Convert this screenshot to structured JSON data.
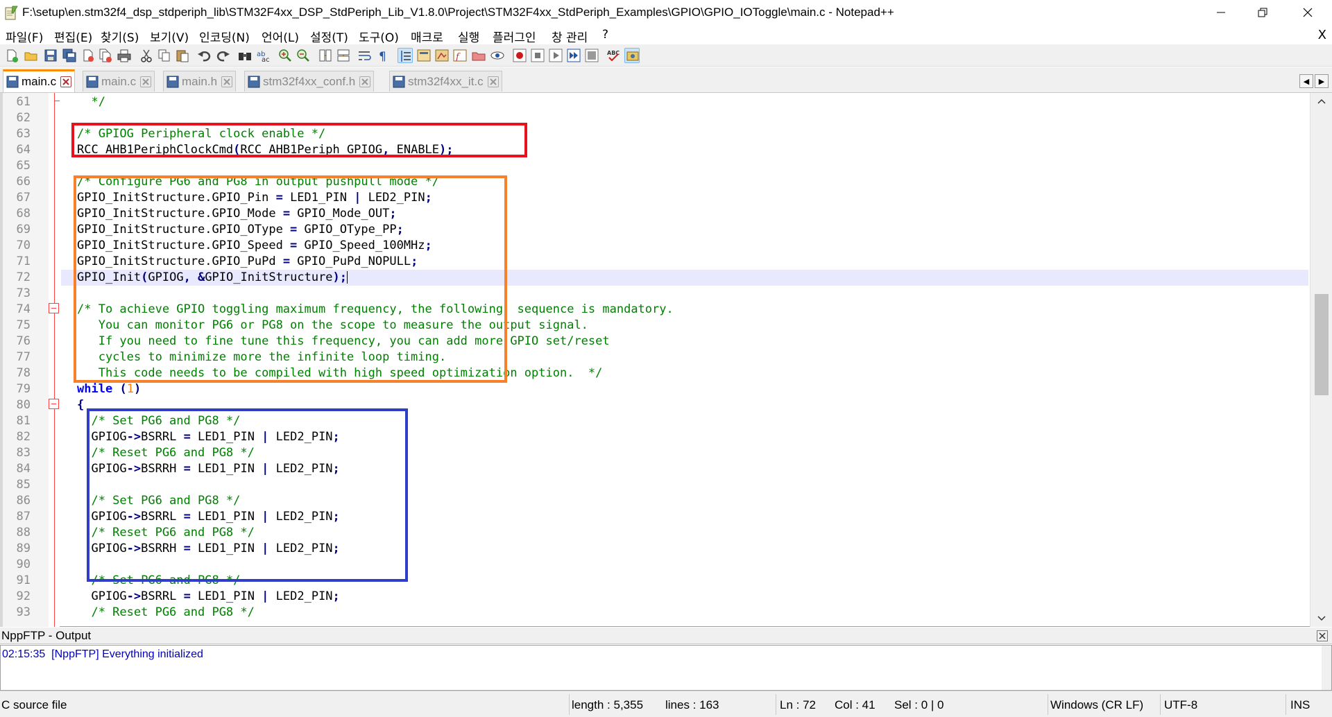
{
  "window": {
    "title": "F:\\setup\\en.stm32f4_dsp_stdperiph_lib\\STM32F4xx_DSP_StdPeriph_Lib_V1.8.0\\Project\\STM32F4xx_StdPeriph_Examples\\GPIO\\GPIO_IOToggle\\main.c - Notepad++",
    "app_icon": "notepad-plus-plus-icon",
    "minimize_icon": "minimize-icon",
    "restore_icon": "restore-icon",
    "close_icon": "close-icon"
  },
  "menu": {
    "items": [
      "파일(F)",
      "편집(E)",
      "찾기(S)",
      "보기(V)",
      "인코딩(N)",
      "언어(L)",
      "설정(T)",
      "도구(O)",
      "매크로",
      "실행",
      "플러그인",
      "창 관리",
      "?"
    ],
    "close_label": "X"
  },
  "toolbar": {
    "buttons": [
      "new-file",
      "open-file",
      "save",
      "save-all",
      "close",
      "close-all",
      "print",
      "cut",
      "copy",
      "paste",
      "undo",
      "redo",
      "find",
      "replace",
      "zoom-in",
      "zoom-out",
      "sync-vertical",
      "sync-horizontal",
      "word-wrap",
      "show-all-characters",
      "indent-guide",
      "user-defined-language",
      "document-map",
      "function-list",
      "folder-as-workspace",
      "monitoring",
      "record-macro",
      "stop-recording",
      "playback",
      "run-macro-multiple",
      "save-macro",
      "spell-check",
      "plugin"
    ]
  },
  "tabs": [
    {
      "label": "main.c",
      "active": true,
      "icon": "saved-file-icon"
    },
    {
      "label": "main.c",
      "active": false,
      "icon": "saved-file-icon"
    },
    {
      "label": "main.h",
      "active": false,
      "icon": "saved-file-icon"
    },
    {
      "label": "stm32f4xx_conf.h",
      "active": false,
      "icon": "saved-file-icon"
    },
    {
      "label": "stm32f4xx_it.c",
      "active": false,
      "icon": "saved-file-icon"
    }
  ],
  "tab_nav": {
    "left": "◀",
    "right": "▶"
  },
  "editor": {
    "current_line": 72,
    "lines": [
      {
        "n": "61",
        "code": "  */",
        "type": "cmt"
      },
      {
        "n": "62",
        "code": "",
        "type": "plain"
      },
      {
        "n": "63",
        "code": "/* GPIOG Peripheral clock enable */",
        "type": "cmt"
      },
      {
        "n": "64",
        "code": "RCC_AHB1PeriphClockCmd(RCC_AHB1Periph_GPIOG, ENABLE);",
        "type": "call"
      },
      {
        "n": "65",
        "code": "",
        "type": "plain"
      },
      {
        "n": "66",
        "code": "/* Configure PG6 and PG8 in output pushpull mode */",
        "type": "cmt"
      },
      {
        "n": "67",
        "code": "GPIO_InitStructure.GPIO_Pin = LED1_PIN | LED2_PIN;",
        "type": "assign"
      },
      {
        "n": "68",
        "code": "GPIO_InitStructure.GPIO_Mode = GPIO_Mode_OUT;",
        "type": "assign"
      },
      {
        "n": "69",
        "code": "GPIO_InitStructure.GPIO_OType = GPIO_OType_PP;",
        "type": "assign"
      },
      {
        "n": "70",
        "code": "GPIO_InitStructure.GPIO_Speed = GPIO_Speed_100MHz;",
        "type": "assign"
      },
      {
        "n": "71",
        "code": "GPIO_InitStructure.GPIO_PuPd = GPIO_PuPd_NOPULL;",
        "type": "assign"
      },
      {
        "n": "72",
        "code": "GPIO_Init(GPIOG, &GPIO_InitStructure);",
        "type": "call"
      },
      {
        "n": "73",
        "code": "",
        "type": "plain"
      },
      {
        "n": "74",
        "code": "/* To achieve GPIO toggling maximum frequency, the following  sequence is mandatory.",
        "type": "cmt"
      },
      {
        "n": "75",
        "code": "   You can monitor PG6 or PG8 on the scope to measure the output signal.",
        "type": "cmt"
      },
      {
        "n": "76",
        "code": "   If you need to fine tune this frequency, you can add more GPIO set/reset",
        "type": "cmt"
      },
      {
        "n": "77",
        "code": "   cycles to minimize more the infinite loop timing.",
        "type": "cmt"
      },
      {
        "n": "78",
        "code": "   This code needs to be compiled with high speed optimization option.  */",
        "type": "cmt"
      },
      {
        "n": "79",
        "code": "while (1)",
        "type": "while"
      },
      {
        "n": "80",
        "code": "{",
        "type": "brace"
      },
      {
        "n": "81",
        "code": "  /* Set PG6 and PG8 */",
        "type": "cmt"
      },
      {
        "n": "82",
        "code": "  GPIOG->BSRRL = LED1_PIN | LED2_PIN;",
        "type": "assign"
      },
      {
        "n": "83",
        "code": "  /* Reset PG6 and PG8 */",
        "type": "cmt"
      },
      {
        "n": "84",
        "code": "  GPIOG->BSRRH = LED1_PIN | LED2_PIN;",
        "type": "assign"
      },
      {
        "n": "85",
        "code": "",
        "type": "plain"
      },
      {
        "n": "86",
        "code": "  /* Set PG6 and PG8 */",
        "type": "cmt"
      },
      {
        "n": "87",
        "code": "  GPIOG->BSRRL = LED1_PIN | LED2_PIN;",
        "type": "assign"
      },
      {
        "n": "88",
        "code": "  /* Reset PG6 and PG8 */",
        "type": "cmt"
      },
      {
        "n": "89",
        "code": "  GPIOG->BSRRH = LED1_PIN | LED2_PIN;",
        "type": "assign"
      },
      {
        "n": "90",
        "code": "",
        "type": "plain"
      },
      {
        "n": "91",
        "code": "  /* Set PG6 and PG8 */",
        "type": "cmt"
      },
      {
        "n": "92",
        "code": "  GPIOG->BSRRL = LED1_PIN | LED2_PIN;",
        "type": "assign"
      },
      {
        "n": "93",
        "code": "  /* Reset PG6 and PG8 */",
        "type": "cmt"
      }
    ],
    "highlight_colors": {
      "red": "#e8121e",
      "orange": "#f7812a",
      "blue": "#2f3ec8"
    }
  },
  "panel": {
    "title": "NppFTP - Output",
    "log_line": "02:15:35  [NppFTP] Everything initialized"
  },
  "status": {
    "file_type": "C source file",
    "length": "length : 5,355",
    "lines": "lines : 163",
    "ln": "Ln : 72",
    "col": "Col : 41",
    "sel": "Sel : 0 | 0",
    "eol": "Windows (CR LF)",
    "encoding": "UTF-8",
    "mode": "INS"
  }
}
